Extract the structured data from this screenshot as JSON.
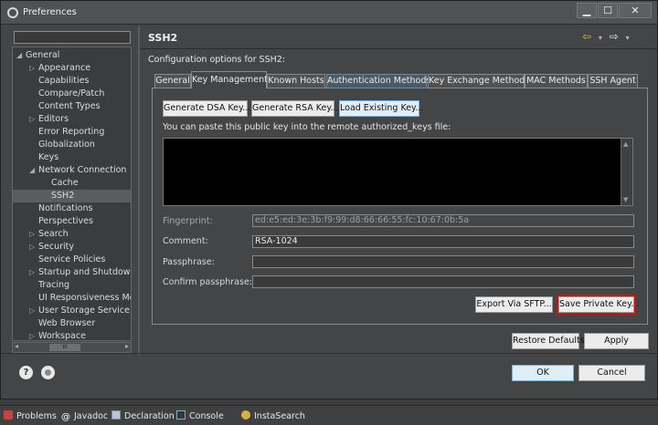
{
  "window": {
    "title": "Preferences",
    "minimize": "▁",
    "maximize": "☐",
    "close": "✕"
  },
  "filter": {
    "placeholder": ""
  },
  "tree": {
    "items": [
      {
        "label": "General",
        "arrow": "◢"
      },
      {
        "label": "Appearance",
        "arrow": "▷"
      },
      {
        "label": "Capabilities",
        "arrow": ""
      },
      {
        "label": "Compare/Patch",
        "arrow": ""
      },
      {
        "label": "Content Types",
        "arrow": ""
      },
      {
        "label": "Editors",
        "arrow": "▷"
      },
      {
        "label": "Error Reporting",
        "arrow": ""
      },
      {
        "label": "Globalization",
        "arrow": ""
      },
      {
        "label": "Keys",
        "arrow": ""
      },
      {
        "label": "Network Connection",
        "arrow": "◢"
      },
      {
        "label": "Cache",
        "arrow": ""
      },
      {
        "label": "SSH2",
        "arrow": ""
      },
      {
        "label": "Notifications",
        "arrow": ""
      },
      {
        "label": "Perspectives",
        "arrow": ""
      },
      {
        "label": "Search",
        "arrow": "▷"
      },
      {
        "label": "Security",
        "arrow": "▷"
      },
      {
        "label": "Service Policies",
        "arrow": ""
      },
      {
        "label": "Startup and Shutdown",
        "arrow": "▷"
      },
      {
        "label": "Tracing",
        "arrow": ""
      },
      {
        "label": "UI Responsiveness Monitoring",
        "arrow": ""
      },
      {
        "label": "User Storage Service",
        "arrow": "▷"
      },
      {
        "label": "Web Browser",
        "arrow": ""
      },
      {
        "label": "Workspace",
        "arrow": "▷"
      }
    ],
    "hscroll_grip": "III"
  },
  "page": {
    "title": "SSH2",
    "back_arrow": "⇦",
    "forward_arrow": "⇨",
    "dropdown": "▾",
    "config_label": "Configuration options for SSH2:"
  },
  "tabs": [
    "General",
    "Key Management",
    "Known Hosts",
    "Authentication Methods",
    "Key Exchange Methods",
    "MAC Methods",
    "SSH Agent"
  ],
  "key_mgmt": {
    "gen_dsa": "Generate DSA Key...",
    "gen_rsa": "Generate RSA Key...",
    "load_existing": "Load Existing Key...",
    "paste_label": "You can paste this public key into the remote authorized_keys file:",
    "fingerprint_label": "Fingerprint:",
    "fingerprint_value": "ed:e5:ed:3e:3b:f9:99:d8:66:66:55:fc:10:67:0b:5a",
    "comment_label": "Comment:",
    "comment_value": "RSA-1024",
    "passphrase_label": "Passphrase:",
    "passphrase_value": "",
    "confirm_label": "Confirm passphrase:",
    "confirm_value": "",
    "export_sftp": "Export Via SFTP...",
    "save_private": "Save Private Key..."
  },
  "footer": {
    "restore_defaults": "Restore Defaults",
    "apply": "Apply",
    "ok": "OK",
    "cancel": "Cancel",
    "help": "?"
  },
  "views": [
    "Problems",
    "Javadoc",
    "Declaration",
    "Console",
    "InstaSearch"
  ],
  "colors": {
    "highlight_border": "#d01010",
    "key_area": "#000000"
  }
}
